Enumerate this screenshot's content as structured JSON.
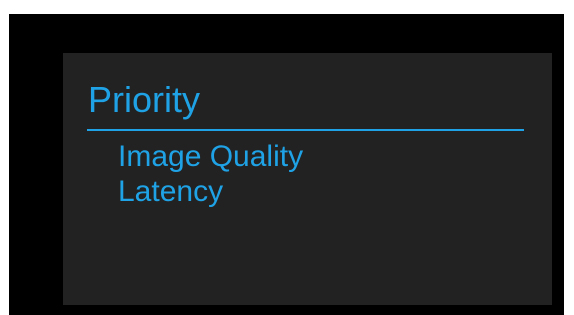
{
  "menu": {
    "title": "Priority",
    "options": [
      {
        "label": "Image Quality"
      },
      {
        "label": "Latency"
      }
    ]
  },
  "colors": {
    "outer_background": "#000000",
    "panel_background": "#222222",
    "accent": "#1fa3e6"
  }
}
